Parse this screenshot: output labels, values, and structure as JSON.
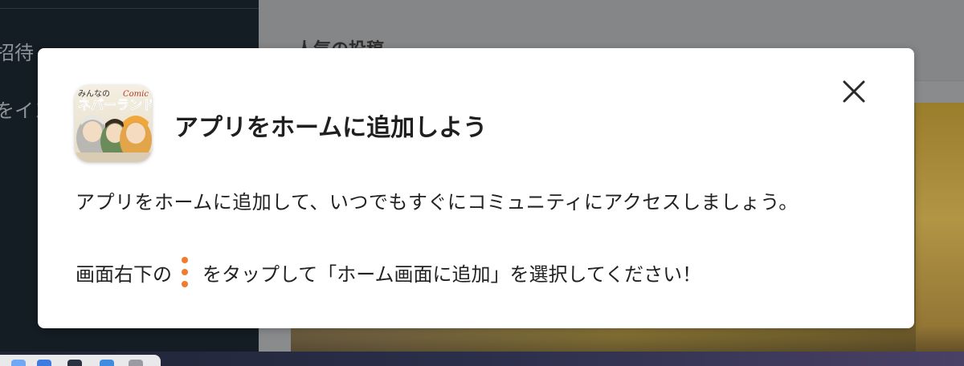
{
  "background": {
    "sidebar": {
      "items": [
        {
          "label": "招待"
        },
        {
          "label": "をイン"
        }
      ]
    },
    "main": {
      "section_title": "人気の投稿"
    }
  },
  "modal": {
    "title": "アプリをホームに追加しよう",
    "app_icon": {
      "caption_top": "みんなの",
      "caption_main": "ネバーランド",
      "caption_logo": "Comic"
    },
    "description": "アプリをホームに追加して、いつでもすぐにコミュニティにアクセスしましょう。",
    "instruction_before": "画面右下の",
    "instruction_icon": "kebab-menu-icon",
    "instruction_after": "をタップして「ホーム画面に追加」を選択してください！",
    "close_icon": "close-icon"
  },
  "colors": {
    "accent_orange": "#f07c30",
    "title_text": "#1f1f1f",
    "body_text": "#222222"
  }
}
